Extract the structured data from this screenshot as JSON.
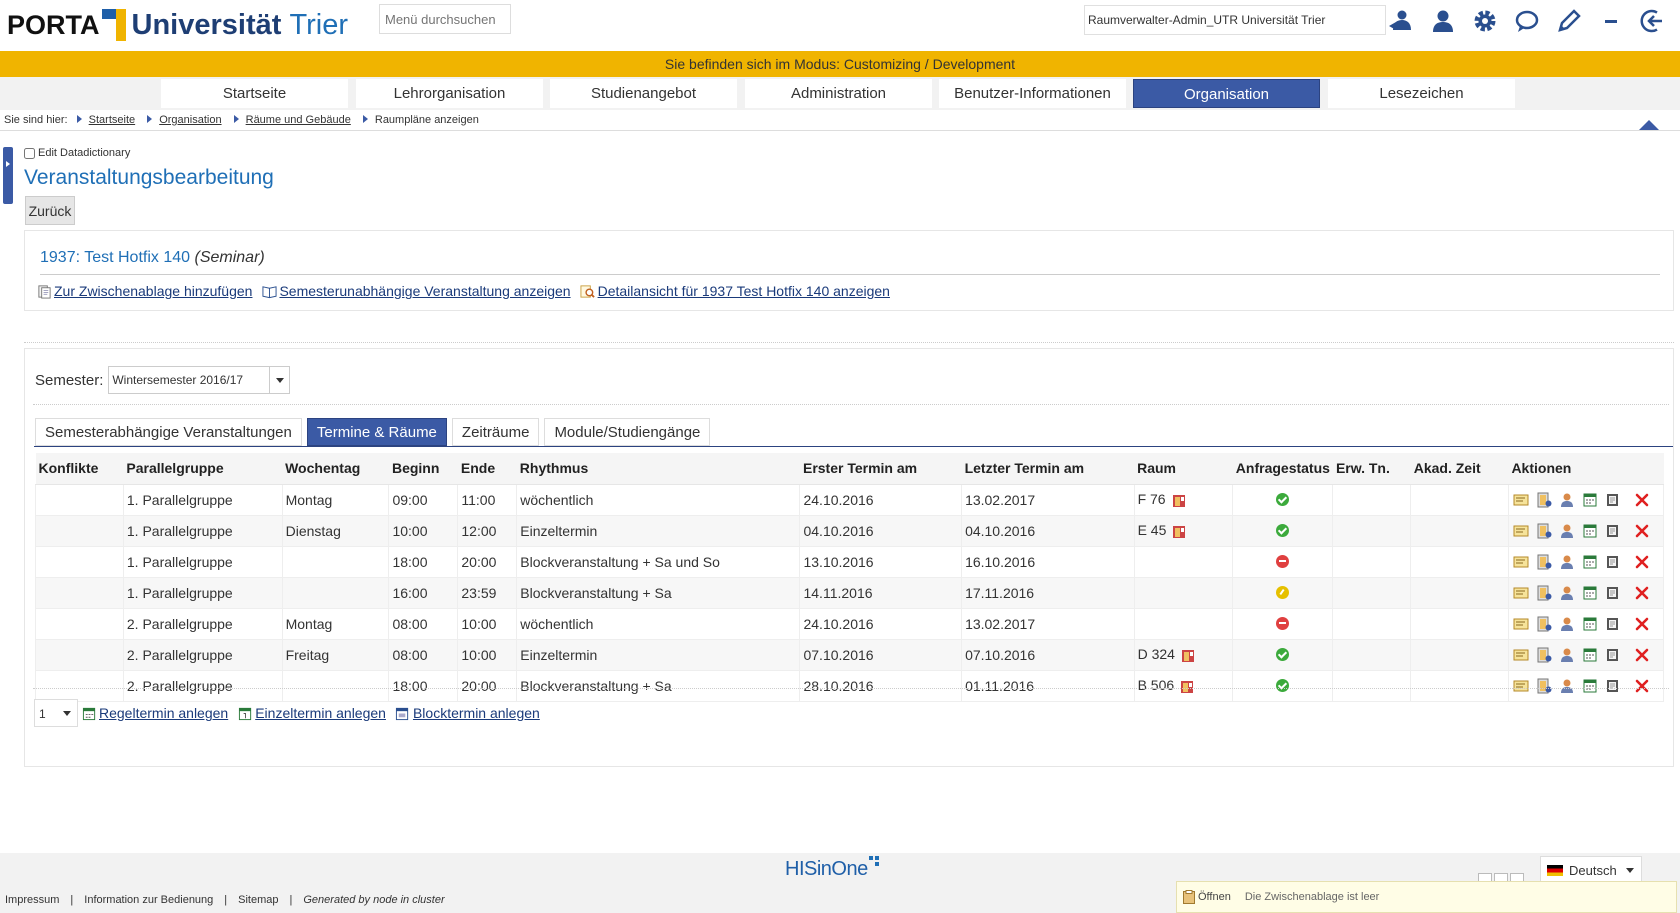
{
  "header": {
    "logo_porta": "PORTA",
    "logo_uni": "Universität",
    "logo_city": "Trier",
    "search_placeholder": "Menü durchsuchen",
    "role": "Raumverwalter-Admin_UTR Universität Trier",
    "icons": [
      "role-switch-icon",
      "user-icon",
      "gear-icon",
      "chat-icon",
      "pencil-icon",
      "minimize-icon",
      "logout-icon"
    ]
  },
  "mode_bar": "Sie befinden sich im Modus: Customizing / Development",
  "nav": {
    "tabs": [
      {
        "label": "Startseite",
        "active": false
      },
      {
        "label": "Lehrorganisation",
        "active": false
      },
      {
        "label": "Studienangebot",
        "active": false
      },
      {
        "label": "Administration",
        "active": false
      },
      {
        "label": "Benutzer-Informationen",
        "active": false
      },
      {
        "label": "Organisation",
        "active": true
      },
      {
        "label": "Lesezeichen",
        "active": false
      }
    ]
  },
  "breadcrumb": {
    "prefix": "Sie sind hier:",
    "items": [
      "Startseite",
      "Organisation",
      "Räume und Gebäude"
    ],
    "current": "Raumpläne anzeigen"
  },
  "page": {
    "edit_dictionary_label": "Edit Datadictionary",
    "title": "Veranstaltungsbearbeitung",
    "back_label": "Zurück"
  },
  "event": {
    "title": "1937: Test Hotfix 140",
    "type": "(Seminar)",
    "links": [
      {
        "label": "Zur Zwischenablage hinzufügen",
        "icon": "clipboard-add-icon"
      },
      {
        "label": "Semesterunabhängige Veranstaltung anzeigen",
        "icon": "book-icon"
      },
      {
        "label": "Detailansicht für 1937 Test Hotfix 140 anzeigen",
        "icon": "magnifier-icon"
      }
    ]
  },
  "semester": {
    "label": "Semester:",
    "selected": "Wintersemester 2016/17"
  },
  "subtabs": [
    {
      "label": "Semesterabhängige Veranstaltungen",
      "active": false
    },
    {
      "label": "Termine & Räume",
      "active": true
    },
    {
      "label": "Zeiträume",
      "active": false
    },
    {
      "label": "Module/Studiengänge",
      "active": false
    }
  ],
  "table": {
    "headers": [
      "Konflikte",
      "Parallelgruppe",
      "Wochentag",
      "Beginn",
      "Ende",
      "Rhythmus",
      "Erster Termin am",
      "Letzter Termin am",
      "Raum",
      "Anfragestatus",
      "Erw. Tn.",
      "Akad. Zeit",
      "Aktionen"
    ],
    "rows": [
      {
        "konflikte": "",
        "gruppe": "1. Parallelgruppe",
        "tag": "Montag",
        "beginn": "09:00",
        "ende": "11:00",
        "rhythmus": "wöchentlich",
        "erster": "24.10.2016",
        "letzter": "13.02.2017",
        "raum": "F 76",
        "status": "ok",
        "erw": "",
        "akad": ""
      },
      {
        "konflikte": "",
        "gruppe": "1. Parallelgruppe",
        "tag": "Dienstag",
        "beginn": "10:00",
        "ende": "12:00",
        "rhythmus": "Einzeltermin",
        "erster": "04.10.2016",
        "letzter": "04.10.2016",
        "raum": "E 45",
        "status": "ok",
        "erw": "",
        "akad": ""
      },
      {
        "konflikte": "",
        "gruppe": "1. Parallelgruppe",
        "tag": "",
        "beginn": "18:00",
        "ende": "20:00",
        "rhythmus": "Blockveranstaltung + Sa und So",
        "erster": "13.10.2016",
        "letzter": "16.10.2016",
        "raum": "",
        "status": "denied",
        "erw": "",
        "akad": ""
      },
      {
        "konflikte": "",
        "gruppe": "1. Parallelgruppe",
        "tag": "",
        "beginn": "16:00",
        "ende": "23:59",
        "rhythmus": "Blockveranstaltung + Sa",
        "erster": "14.11.2016",
        "letzter": "17.11.2016",
        "raum": "",
        "status": "pending",
        "erw": "",
        "akad": ""
      },
      {
        "konflikte": "",
        "gruppe": "2. Parallelgruppe",
        "tag": "Montag",
        "beginn": "08:00",
        "ende": "10:00",
        "rhythmus": "wöchentlich",
        "erster": "24.10.2016",
        "letzter": "13.02.2017",
        "raum": "",
        "status": "denied",
        "erw": "",
        "akad": ""
      },
      {
        "konflikte": "",
        "gruppe": "2. Parallelgruppe",
        "tag": "Freitag",
        "beginn": "08:00",
        "ende": "10:00",
        "rhythmus": "Einzeltermin",
        "erster": "07.10.2016",
        "letzter": "07.10.2016",
        "raum": "D 324",
        "status": "ok",
        "erw": "",
        "akad": ""
      },
      {
        "konflikte": "",
        "gruppe": "2. Parallelgruppe",
        "tag": "",
        "beginn": "18:00",
        "ende": "20:00",
        "rhythmus": "Blockveranstaltung + Sa",
        "erster": "28.10.2016",
        "letzter": "01.11.2016",
        "raum": "B 506",
        "status": "ok",
        "erw": "",
        "akad": ""
      }
    ],
    "action_icons": [
      "edit-note-icon",
      "room-request-icon",
      "lecturer-icon",
      "calendar-icon",
      "notebook-icon",
      "delete-icon"
    ]
  },
  "create": {
    "count": "1",
    "links": [
      {
        "label": "Regeltermin anlegen",
        "icon": "calendar-add-icon"
      },
      {
        "label": "Einzeltermin anlegen",
        "icon": "calendar-add-icon"
      },
      {
        "label": "Blocktermin anlegen",
        "icon": "calendar-add-icon"
      }
    ]
  },
  "footer": {
    "brand": "HISinOne",
    "links": [
      "Impressum",
      "Information zur Bedienung",
      "Sitemap"
    ],
    "generated": "Generated by node in cluster",
    "language": "Deutsch",
    "clipboard_open": "Öffnen",
    "clipboard_empty": "Die Zwischenablage ist leer"
  },
  "colors": {
    "brand_blue": "#3b5aa5",
    "link_blue": "#1f6fb6",
    "mode_yellow": "#f0b400",
    "status_ok": "#3caa3c",
    "status_denied": "#e04040",
    "status_pending": "#e6c000"
  }
}
